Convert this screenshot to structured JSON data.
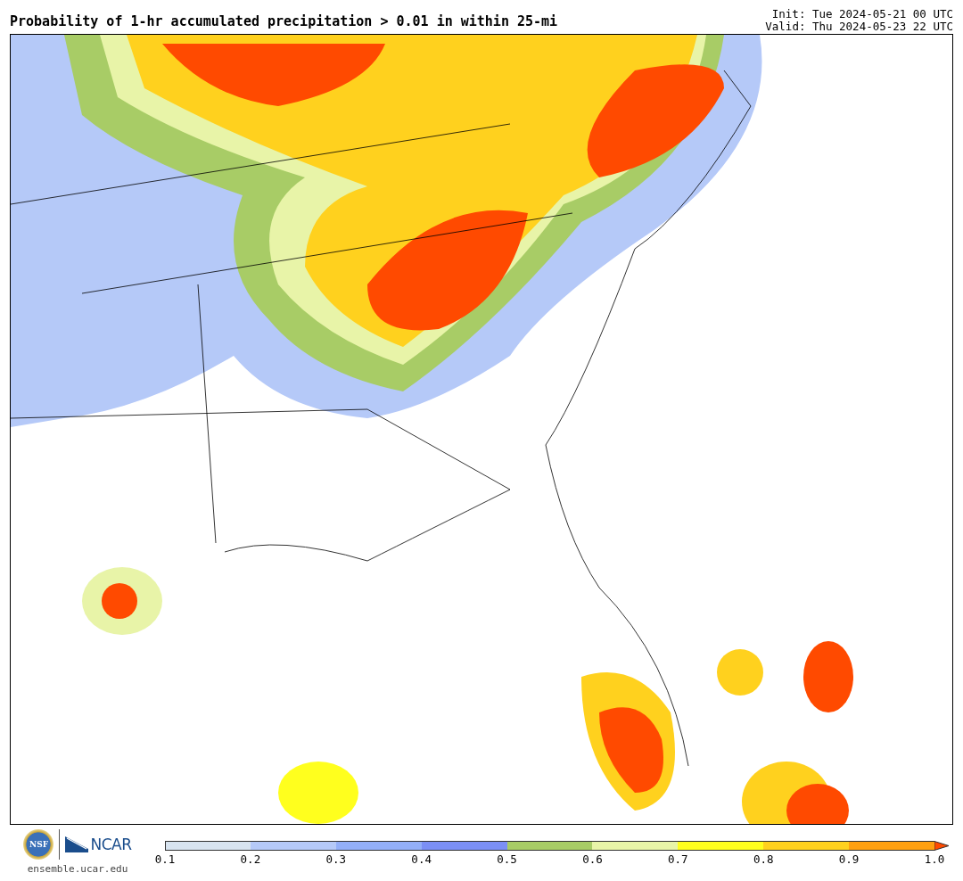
{
  "title": "Probability of 1-hr accumulated precipitation > 0.01 in within 25-mi",
  "run_info": [
    "Init: Tue 2024-05-21 00 UTC",
    "Valid: Thu 2024-05-23 22 UTC"
  ],
  "logos": {
    "seal": "NSF",
    "wordmark": "NCAR",
    "site": "ensemble.ucar.edu"
  },
  "colorbar": {
    "bins": [
      {
        "color": "#d8e4f0"
      },
      {
        "color": "#b5c9f8"
      },
      {
        "color": "#93aff8"
      },
      {
        "color": "#7b8ff5"
      },
      {
        "color": "#a8cc66"
      },
      {
        "color": "#e8f4a8"
      },
      {
        "color": "#ffff1e"
      },
      {
        "color": "#ffd11e"
      },
      {
        "color": "#ffa00f"
      }
    ],
    "extend": {
      "color": "#ff4a00"
    },
    "ticks": [
      "0.1",
      "0.2",
      "0.3",
      "0.4",
      "0.5",
      "0.6",
      "0.7",
      "0.8",
      "0.9",
      "1.0"
    ]
  }
}
